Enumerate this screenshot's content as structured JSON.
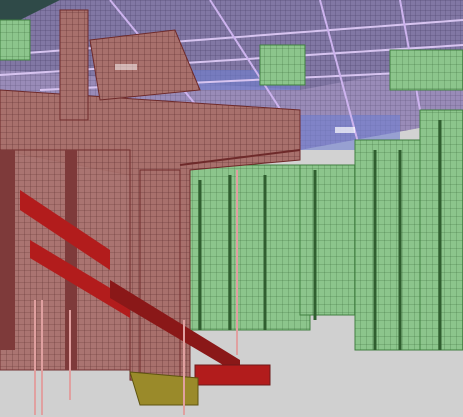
{
  "viewport": {
    "background_color": "#d2d2d2",
    "sky_color": "#2f4a48"
  },
  "model": {
    "colors": {
      "red_frame": "#a8706c",
      "red_frame_dark": "#6e2a2a",
      "red_stairs": "#b21c1c",
      "green_forms": "#8cc58c",
      "green_forms_dark": "#3f7e3f",
      "purple_beams": "#8f7fb4",
      "blue_beams": "#6f7fd0",
      "yellow_base": "#9a8a2a",
      "pink_posts": "#e0a0a0"
    }
  }
}
